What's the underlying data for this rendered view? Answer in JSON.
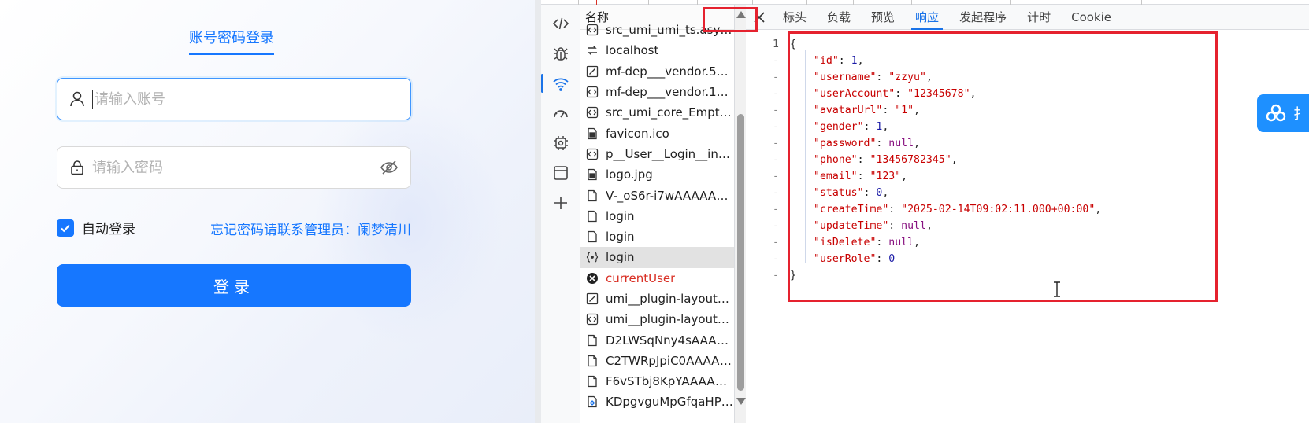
{
  "login": {
    "tab_label": "账号密码登录",
    "account_placeholder": "请输入账号",
    "password_placeholder": "请输入密码",
    "remember_label": "自动登录",
    "remember_checked": true,
    "forgot_text": "忘记密码请联系管理员：阑梦清川",
    "submit_label": "登录",
    "accent_color": "#1677ff"
  },
  "devtools": {
    "sidebar_icons": [
      "code-icon",
      "bug-icon",
      "network-icon",
      "performance-icon",
      "memory-icon",
      "application-icon",
      "add-icon"
    ],
    "request_list": {
      "header": "名称",
      "rows": [
        {
          "name": "src_umi_umi_ts.async.js",
          "icon": "script-icon",
          "state": "normal"
        },
        {
          "name": "localhost",
          "icon": "redirect-icon",
          "state": "normal"
        },
        {
          "name": "mf-dep___vendor.5a1...",
          "icon": "edit-icon",
          "state": "normal"
        },
        {
          "name": "mf-dep___vendor.1d9...",
          "icon": "script-icon",
          "state": "normal"
        },
        {
          "name": "src_umi_core_EmptyRo...",
          "icon": "script-icon",
          "state": "normal"
        },
        {
          "name": "favicon.ico",
          "icon": "image-icon",
          "state": "normal"
        },
        {
          "name": "p__User__Login__index...",
          "icon": "script-icon",
          "state": "normal"
        },
        {
          "name": "logo.jpg",
          "icon": "image-icon",
          "state": "normal"
        },
        {
          "name": "V-_oS6r-i7wAAAAAAA...",
          "icon": "document-icon",
          "state": "normal"
        },
        {
          "name": "login",
          "icon": "file-icon",
          "state": "normal"
        },
        {
          "name": "login",
          "icon": "file-icon",
          "state": "normal"
        },
        {
          "name": "login",
          "icon": "fetch-icon",
          "state": "selected"
        },
        {
          "name": "currentUser",
          "icon": "error-icon",
          "state": "error"
        },
        {
          "name": "umi__plugin-layout__L...",
          "icon": "edit-icon",
          "state": "normal"
        },
        {
          "name": "umi__plugin-layout__L...",
          "icon": "script-icon",
          "state": "normal"
        },
        {
          "name": "D2LWSqNny4sAAAAA...",
          "icon": "document-icon",
          "state": "normal"
        },
        {
          "name": "C2TWRpJpiC0AAAAA...",
          "icon": "document-icon",
          "state": "normal"
        },
        {
          "name": "F6vSTbj8KpYAAAAAA...",
          "icon": "document-icon",
          "state": "normal"
        },
        {
          "name": "KDpgvguMpGfqaHPjic...",
          "icon": "svg-icon",
          "state": "normal"
        }
      ]
    },
    "tabs": [
      {
        "label": "标头",
        "active": false
      },
      {
        "label": "负载",
        "active": false
      },
      {
        "label": "预览",
        "active": false
      },
      {
        "label": "响应",
        "active": true
      },
      {
        "label": "发起程序",
        "active": false
      },
      {
        "label": "计时",
        "active": false
      },
      {
        "label": "Cookie",
        "active": false
      }
    ],
    "response_lines": [
      {
        "gutter": "1",
        "tokens": [
          {
            "t": "{",
            "c": "p"
          }
        ]
      },
      {
        "gutter": "-",
        "indent": 1,
        "tokens": [
          {
            "t": "\"id\"",
            "c": "k"
          },
          {
            "t": ": ",
            "c": "p"
          },
          {
            "t": "1",
            "c": "n"
          },
          {
            "t": ",",
            "c": "p"
          }
        ]
      },
      {
        "gutter": "-",
        "indent": 1,
        "tokens": [
          {
            "t": "\"username\"",
            "c": "k"
          },
          {
            "t": ": ",
            "c": "p"
          },
          {
            "t": "\"zzyu\"",
            "c": "s"
          },
          {
            "t": ",",
            "c": "p"
          }
        ]
      },
      {
        "gutter": "-",
        "indent": 1,
        "tokens": [
          {
            "t": "\"userAccount\"",
            "c": "k"
          },
          {
            "t": ": ",
            "c": "p"
          },
          {
            "t": "\"12345678\"",
            "c": "s"
          },
          {
            "t": ",",
            "c": "p"
          }
        ]
      },
      {
        "gutter": "-",
        "indent": 1,
        "tokens": [
          {
            "t": "\"avatarUrl\"",
            "c": "k"
          },
          {
            "t": ": ",
            "c": "p"
          },
          {
            "t": "\"1\"",
            "c": "s"
          },
          {
            "t": ",",
            "c": "p"
          }
        ]
      },
      {
        "gutter": "-",
        "indent": 1,
        "tokens": [
          {
            "t": "\"gender\"",
            "c": "k"
          },
          {
            "t": ": ",
            "c": "p"
          },
          {
            "t": "1",
            "c": "n"
          },
          {
            "t": ",",
            "c": "p"
          }
        ]
      },
      {
        "gutter": "-",
        "indent": 1,
        "tokens": [
          {
            "t": "\"password\"",
            "c": "k"
          },
          {
            "t": ": ",
            "c": "p"
          },
          {
            "t": "null",
            "c": "lit"
          },
          {
            "t": ",",
            "c": "p"
          }
        ]
      },
      {
        "gutter": "-",
        "indent": 1,
        "tokens": [
          {
            "t": "\"phone\"",
            "c": "k"
          },
          {
            "t": ": ",
            "c": "p"
          },
          {
            "t": "\"13456782345\"",
            "c": "s"
          },
          {
            "t": ",",
            "c": "p"
          }
        ]
      },
      {
        "gutter": "-",
        "indent": 1,
        "tokens": [
          {
            "t": "\"email\"",
            "c": "k"
          },
          {
            "t": ": ",
            "c": "p"
          },
          {
            "t": "\"123\"",
            "c": "s"
          },
          {
            "t": ",",
            "c": "p"
          }
        ]
      },
      {
        "gutter": "-",
        "indent": 1,
        "tokens": [
          {
            "t": "\"status\"",
            "c": "k"
          },
          {
            "t": ": ",
            "c": "p"
          },
          {
            "t": "0",
            "c": "n"
          },
          {
            "t": ",",
            "c": "p"
          }
        ]
      },
      {
        "gutter": "-",
        "indent": 1,
        "tokens": [
          {
            "t": "\"createTime\"",
            "c": "k"
          },
          {
            "t": ": ",
            "c": "p"
          },
          {
            "t": "\"2025-02-14T09:02:11.000+00:00\"",
            "c": "s"
          },
          {
            "t": ",",
            "c": "p"
          }
        ]
      },
      {
        "gutter": "-",
        "indent": 1,
        "tokens": [
          {
            "t": "\"updateTime\"",
            "c": "k"
          },
          {
            "t": ": ",
            "c": "p"
          },
          {
            "t": "null",
            "c": "lit"
          },
          {
            "t": ",",
            "c": "p"
          }
        ]
      },
      {
        "gutter": "-",
        "indent": 1,
        "tokens": [
          {
            "t": "\"isDelete\"",
            "c": "k"
          },
          {
            "t": ": ",
            "c": "p"
          },
          {
            "t": "null",
            "c": "lit"
          },
          {
            "t": ",",
            "c": "p"
          }
        ]
      },
      {
        "gutter": "-",
        "indent": 1,
        "tokens": [
          {
            "t": "\"userRole\"",
            "c": "k"
          },
          {
            "t": ": ",
            "c": "p"
          },
          {
            "t": "0",
            "c": "n"
          }
        ]
      },
      {
        "gutter": "-",
        "tokens": [
          {
            "t": "}",
            "c": "p"
          }
        ]
      }
    ],
    "highlight_color": "#e5222f"
  },
  "extension_badge": {
    "text": "扌",
    "icon": "baidu-netdisk-icon"
  }
}
